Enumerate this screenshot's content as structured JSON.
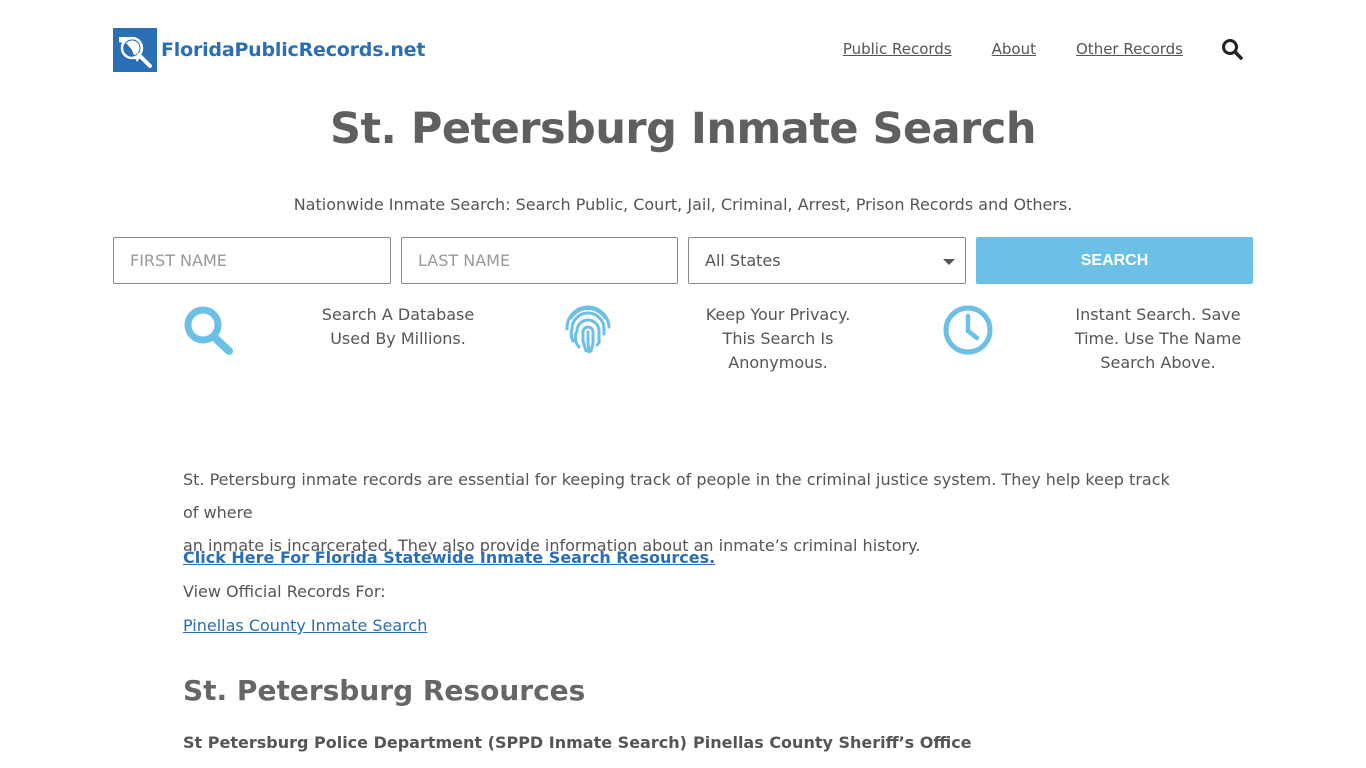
{
  "header": {
    "logo_text": "FloridaPublicRecords.net",
    "nav": [
      "Public Records",
      "About",
      "Other Records"
    ]
  },
  "page": {
    "title": "St. Petersburg Inmate Search",
    "subtitle": "Nationwide Inmate Search: Search Public, Court, Jail, Criminal, Arrest, Prison Records and Others."
  },
  "search_form": {
    "first_name_placeholder": "FIRST NAME",
    "last_name_placeholder": "LAST NAME",
    "state_selected": "All States",
    "search_label": "SEARCH"
  },
  "features": [
    {
      "icon": "magnifier-icon",
      "text_line1": "Search A Database",
      "text_line2": "Used By Millions.",
      "text_line3": ""
    },
    {
      "icon": "fingerprint-icon",
      "text_line1": "Keep Your Privacy.",
      "text_line2": "This Search Is",
      "text_line3": "Anonymous."
    },
    {
      "icon": "clock-icon",
      "text_line1": "Instant Search. Save",
      "text_line2": "Time. Use The Name",
      "text_line3": "Search Above."
    }
  ],
  "content": {
    "intro_line1": "St. Petersburg inmate records are essential for keeping track of people in the criminal justice system. They help keep track of where",
    "intro_line2": "an inmate is incarcerated. They also provide information about an inmate’s criminal history.",
    "statewide_link": "Click Here For Florida Statewide Inmate Search Resources.",
    "view_label": "View Official Records For:",
    "county_link": "Pinellas County Inmate Search",
    "resources_heading": "St. Petersburg Resources",
    "resources": [
      "St Petersburg Police Department (SPPD Inmate Search)",
      "Pinellas County Sheriff’s Office"
    ]
  },
  "colors": {
    "brand_blue": "#2a6fb5",
    "accent_light_blue": "#6cc0e5",
    "text_gray": "#555555"
  }
}
